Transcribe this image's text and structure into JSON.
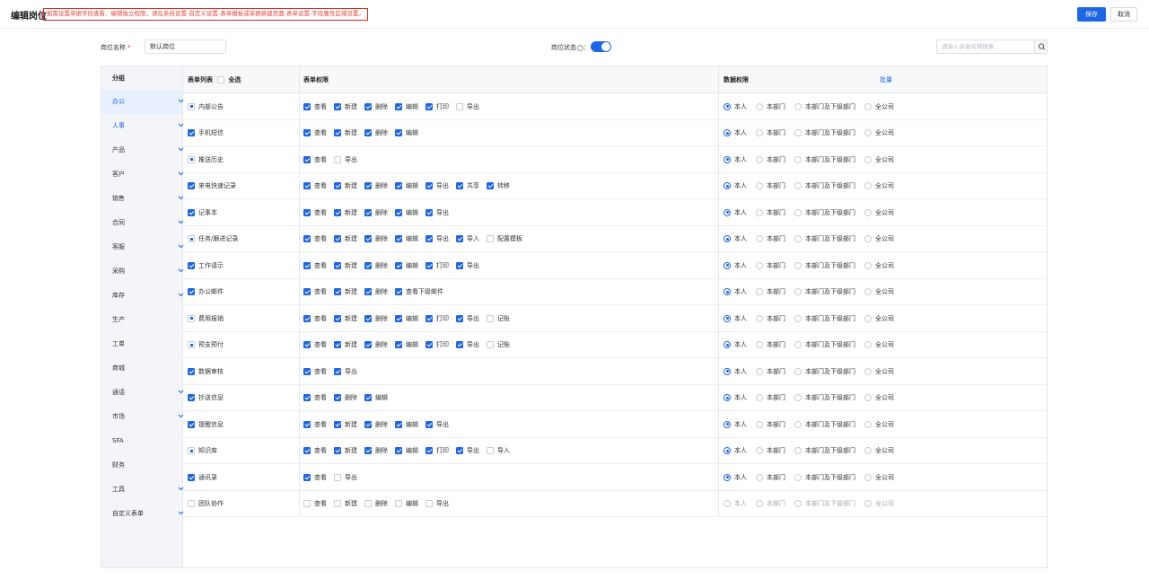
{
  "header": {
    "title": "编辑岗位",
    "notice": "如需设置单据字段查看、编辑独立权限，请在系统设置-自定义设置-表单模板或单据新建页面-表单设置-字段属性区域设置。",
    "save_label": "保存",
    "cancel_label": "取消"
  },
  "form": {
    "name_label": "岗位名称",
    "required_mark": "*",
    "name_value": "默认岗位",
    "status_label": "岗位状态",
    "status_suffix": "：",
    "status_on": true,
    "search_placeholder": "请输入单据名称搜索"
  },
  "sidebar": {
    "header": "分组",
    "groups": [
      {
        "label": "办公",
        "active": true,
        "chevron": true
      },
      {
        "label": "人事",
        "active": false,
        "chevron": true,
        "highlight": true
      },
      {
        "label": "产品",
        "active": false,
        "chevron": true
      },
      {
        "label": "客户",
        "active": false,
        "chevron": true
      },
      {
        "label": "销售",
        "active": false,
        "chevron": true
      },
      {
        "label": "合同",
        "active": false,
        "chevron": true
      },
      {
        "label": "客服",
        "active": false,
        "chevron": true
      },
      {
        "label": "采购",
        "active": false,
        "chevron": true
      },
      {
        "label": "库存",
        "active": false,
        "chevron": true
      },
      {
        "label": "生产",
        "active": false,
        "chevron": false
      },
      {
        "label": "工单",
        "active": false,
        "chevron": false
      },
      {
        "label": "商城",
        "active": false,
        "chevron": false
      },
      {
        "label": "通话",
        "active": false,
        "chevron": true
      },
      {
        "label": "市场",
        "active": false,
        "chevron": true
      },
      {
        "label": "SFA",
        "active": false,
        "chevron": false
      },
      {
        "label": "财务",
        "active": false,
        "chevron": false
      },
      {
        "label": "工具",
        "active": false,
        "chevron": true
      },
      {
        "label": "自定义表单",
        "active": false,
        "chevron": true
      }
    ]
  },
  "table": {
    "col_forms": "表单列表",
    "select_all": "全选",
    "col_form_perm": "表单权限",
    "col_data_perm": "数据权限",
    "batch_label": "批量",
    "data_scopes": [
      "本人",
      "本部门",
      "本部门及下级部门",
      "全公司"
    ],
    "rows": [
      {
        "name": "内部公告",
        "state": "half",
        "perms": [
          [
            "查看",
            1
          ],
          [
            "新建",
            1
          ],
          [
            "删除",
            1
          ],
          [
            "编辑",
            1
          ],
          [
            "打印",
            1
          ],
          [
            "导出",
            0
          ]
        ],
        "scope": 0,
        "disabled": false
      },
      {
        "name": "手机短信",
        "state": "on",
        "perms": [
          [
            "查看",
            1
          ],
          [
            "新建",
            1
          ],
          [
            "删除",
            1
          ],
          [
            "编辑",
            1
          ]
        ],
        "scope": 0,
        "disabled": false
      },
      {
        "name": "推送历史",
        "state": "half",
        "perms": [
          [
            "查看",
            1
          ],
          [
            "导出",
            0
          ]
        ],
        "scope": 0,
        "disabled": false
      },
      {
        "name": "来电快速记录",
        "state": "on",
        "perms": [
          [
            "查看",
            1
          ],
          [
            "新建",
            1
          ],
          [
            "删除",
            1
          ],
          [
            "编辑",
            1
          ],
          [
            "导出",
            1
          ],
          [
            "共享",
            1
          ],
          [
            "转移",
            1
          ]
        ],
        "scope": 0,
        "disabled": false
      },
      {
        "name": "记事本",
        "state": "on",
        "perms": [
          [
            "查看",
            1
          ],
          [
            "新建",
            1
          ],
          [
            "删除",
            1
          ],
          [
            "编辑",
            1
          ],
          [
            "导出",
            1
          ]
        ],
        "scope": 0,
        "disabled": false
      },
      {
        "name": "任务/跟进记录",
        "state": "half",
        "perms": [
          [
            "查看",
            1
          ],
          [
            "新建",
            1
          ],
          [
            "删除",
            1
          ],
          [
            "编辑",
            1
          ],
          [
            "导出",
            1
          ],
          [
            "导入",
            1
          ],
          [
            "配置模板",
            0
          ]
        ],
        "scope": 0,
        "disabled": false
      },
      {
        "name": "工作请示",
        "state": "on",
        "perms": [
          [
            "查看",
            1
          ],
          [
            "新建",
            1
          ],
          [
            "删除",
            1
          ],
          [
            "编辑",
            1
          ],
          [
            "打印",
            1
          ],
          [
            "导出",
            1
          ]
        ],
        "scope": 0,
        "disabled": false
      },
      {
        "name": "办公邮件",
        "state": "on",
        "perms": [
          [
            "查看",
            1
          ],
          [
            "新建",
            1
          ],
          [
            "删除",
            1
          ],
          [
            "查看下级邮件",
            1
          ]
        ],
        "scope": 0,
        "disabled": false
      },
      {
        "name": "费用报销",
        "state": "half",
        "perms": [
          [
            "查看",
            1
          ],
          [
            "新建",
            1
          ],
          [
            "删除",
            1
          ],
          [
            "编辑",
            1
          ],
          [
            "打印",
            1
          ],
          [
            "导出",
            1
          ],
          [
            "记账",
            0
          ]
        ],
        "scope": 0,
        "disabled": false
      },
      {
        "name": "预支预付",
        "state": "half",
        "perms": [
          [
            "查看",
            1
          ],
          [
            "新建",
            1
          ],
          [
            "删除",
            1
          ],
          [
            "编辑",
            1
          ],
          [
            "打印",
            1
          ],
          [
            "导出",
            1
          ],
          [
            "记账",
            0
          ]
        ],
        "scope": 0,
        "disabled": false
      },
      {
        "name": "数据审核",
        "state": "on",
        "perms": [
          [
            "查看",
            1
          ],
          [
            "导出",
            1
          ]
        ],
        "scope": 0,
        "disabled": false
      },
      {
        "name": "抄送信息",
        "state": "on",
        "perms": [
          [
            "查看",
            1
          ],
          [
            "删除",
            1
          ],
          [
            "编辑",
            1
          ]
        ],
        "scope": 0,
        "disabled": false
      },
      {
        "name": "提醒信息",
        "state": "on",
        "perms": [
          [
            "查看",
            1
          ],
          [
            "新建",
            1
          ],
          [
            "删除",
            1
          ],
          [
            "编辑",
            1
          ],
          [
            "导出",
            1
          ]
        ],
        "scope": 0,
        "disabled": false
      },
      {
        "name": "知识库",
        "state": "half",
        "perms": [
          [
            "查看",
            1
          ],
          [
            "新建",
            1
          ],
          [
            "删除",
            1
          ],
          [
            "编辑",
            1
          ],
          [
            "打印",
            1
          ],
          [
            "导出",
            1
          ],
          [
            "导入",
            0
          ]
        ],
        "scope": 0,
        "disabled": false
      },
      {
        "name": "通讯录",
        "state": "on",
        "perms": [
          [
            "查看",
            1
          ],
          [
            "导出",
            0
          ]
        ],
        "scope": 0,
        "disabled": false
      },
      {
        "name": "团队协作",
        "state": "off",
        "perms": [
          [
            "查看",
            0
          ],
          [
            "新建",
            0
          ],
          [
            "删除",
            0
          ],
          [
            "编辑",
            0
          ],
          [
            "导出",
            0
          ]
        ],
        "scope": -1,
        "disabled": true
      }
    ]
  },
  "colors": {
    "accent": "#1d66e5",
    "notice": "#e3241b"
  }
}
